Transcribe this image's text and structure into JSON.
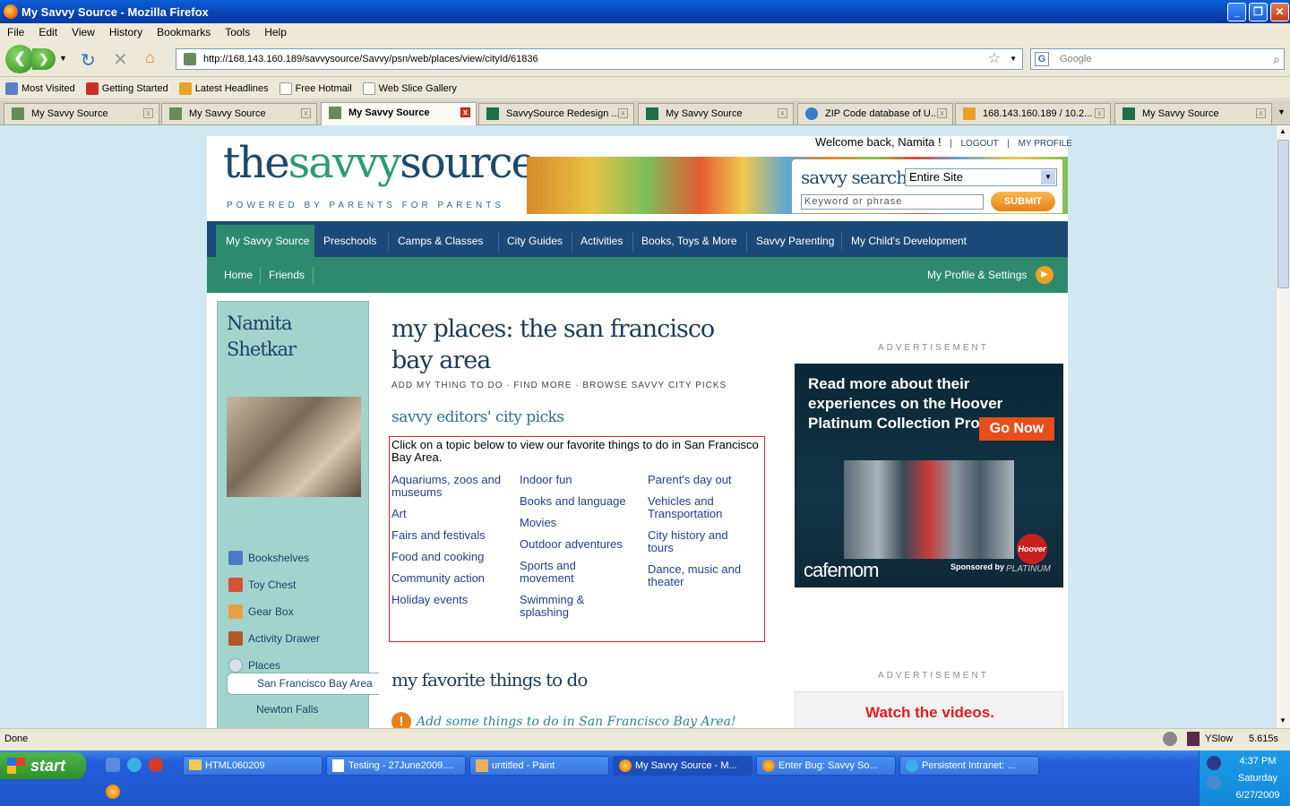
{
  "window": {
    "title": "My Savvy Source - Mozilla Firefox"
  },
  "menu": [
    "File",
    "Edit",
    "View",
    "History",
    "Bookmarks",
    "Tools",
    "Help"
  ],
  "urlbar": {
    "url": "http://168.143.160.189/savvysource/Savvy/psn/web/places/view/cityId/61836",
    "search_placeholder": "Google"
  },
  "bookmarks": [
    "Most Visited",
    "Getting Started",
    "Latest Headlines",
    "Free Hotmail",
    "Web Slice Gallery"
  ],
  "tabs": [
    "My Savvy Source",
    "My Savvy Source",
    "My Savvy Source",
    "SavvySource Redesign ...",
    "My Savvy Source",
    "ZIP Code database of U...",
    "168.143.160.189 / 10.2...",
    "My Savvy Source"
  ],
  "header": {
    "welcome": "Welcome back, Namita !",
    "logout": "LOGOUT",
    "my_profile": "MY PROFILE",
    "logo_the": "the",
    "logo_savvy": "savvy",
    "logo_source": "source",
    "tagline": "POWERED BY PARENTS FOR PARENTS",
    "search_label": "savvy search",
    "search_scope": "Entire Site",
    "search_placeholder": "Keyword or phrase",
    "submit": "SUBMIT"
  },
  "mainnav": [
    "My Savvy Source",
    "Preschools",
    "Camps & Classes",
    "City Guides",
    "Activities",
    "Books, Toys & More",
    "Savvy Parenting",
    "My Child's Development"
  ],
  "subnav": {
    "items": [
      "Home",
      "Friends"
    ],
    "settings": "My Profile & Settings"
  },
  "profile": {
    "first_name": "Namita",
    "last_name": "Shetkar",
    "items": [
      "Bookshelves",
      "Toy Chest",
      "Gear Box",
      "Activity Drawer",
      "Places"
    ],
    "places": [
      "San Francisco Bay Area",
      "Newton Falls"
    ]
  },
  "main": {
    "title": "my places: the san francisco bay area",
    "actions": "ADD MY THING TO DO · FIND MORE · BROWSE SAVVY CITY PICKS",
    "picks_heading": "savvy editors' city picks",
    "picks_intro": "Click on a topic below to view our favorite things to do in San Francisco Bay Area.",
    "picks_col1": [
      "Aquariums, zoos and museums",
      "Art",
      "Fairs and festivals",
      "Food and cooking",
      "Community action",
      "Holiday events"
    ],
    "picks_col2": [
      "Indoor fun",
      "Books and language",
      "Movies",
      "Outdoor adventures",
      "Sports and movement",
      "Swimming & splashing"
    ],
    "picks_col3": [
      "Parent's day out",
      "Vehicles and Transportation",
      "City history and tours",
      "Dance, music and theater"
    ],
    "favorites_heading": "my favorite things to do",
    "add_link": "Add some things to do in San Francisco Bay Area!"
  },
  "ads": {
    "label": "ADVERTISEMENT",
    "ad1_text": "Read more about their experiences on the Hoover Platinum Collection Profile page.",
    "ad1_button": "Go Now",
    "ad1_brand": "cafemom",
    "ad1_sponsor": "Sponsored by",
    "ad1_collection": "PLATINUM",
    "ad1_logo": "Hoover",
    "ad2_text": "Watch the videos."
  },
  "status": {
    "text": "Done",
    "yslow": "YSlow",
    "time": "5.615s"
  },
  "taskbar": {
    "start": "start",
    "tasks": [
      "HTML060209",
      "Testing - 27June2009....",
      "untitled - Paint",
      "My Savvy Source - M...",
      "Enter Bug: Savvy So...",
      "Persistent Intranet: ..."
    ],
    "clock": "4:37 PM",
    "day": "Saturday",
    "date": "6/27/2009"
  },
  "colors": {
    "navy": "#1c4a78",
    "green": "#2e8a6e",
    "link": "#223f8c",
    "pickborder": "#d3202e"
  }
}
